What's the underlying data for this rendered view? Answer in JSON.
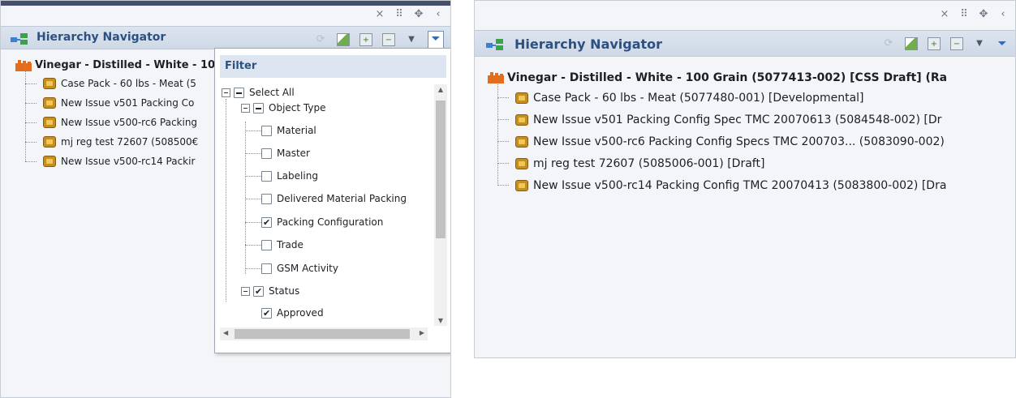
{
  "window_controls": {
    "close": "×",
    "grid": "⠿",
    "move": "✥",
    "back": "‹"
  },
  "header": {
    "title": "Hierarchy Navigator"
  },
  "left_panel": {
    "root": "Vinegar - Distilled - White - 10",
    "children": [
      "Case Pack - 60 lbs - Meat (5",
      "New Issue v501 Packing Co",
      "New Issue v500-rc6 Packing",
      "mj reg test 72607 (508500€",
      "New Issue v500-rc14 Packir"
    ]
  },
  "filter": {
    "title": "Filter",
    "select_all": "Select All",
    "object_type": "Object Type",
    "object_types": [
      {
        "label": "Material",
        "checked": false
      },
      {
        "label": "Master",
        "checked": false
      },
      {
        "label": "Labeling",
        "checked": false
      },
      {
        "label": "Delivered Material Packinɡ",
        "checked": false
      },
      {
        "label": "Packing Configuration",
        "checked": true
      },
      {
        "label": "Trade",
        "checked": false
      },
      {
        "label": "GSM Activity",
        "checked": false
      }
    ],
    "status": "Status",
    "statuses": [
      {
        "label": "Approved",
        "checked": true
      }
    ]
  },
  "right_panel": {
    "root": "Vinegar - Distilled - White - 100 Grain (5077413-002) [CSS Draft] (Ra",
    "children": [
      "Case Pack - 60 lbs - Meat (5077480-001) [Developmental]",
      "New Issue v501 Packing Config Spec TMC 20070613 (5084548-002) [Dr",
      "New Issue v500-rc6 Packing Config Specs TMC 200703... (5083090-002)",
      "mj reg test 72607 (5085006-001) [Draft]",
      "New Issue v500-rc14 Packing Config TMC 20070413 (5083800-002) [Dra"
    ]
  }
}
